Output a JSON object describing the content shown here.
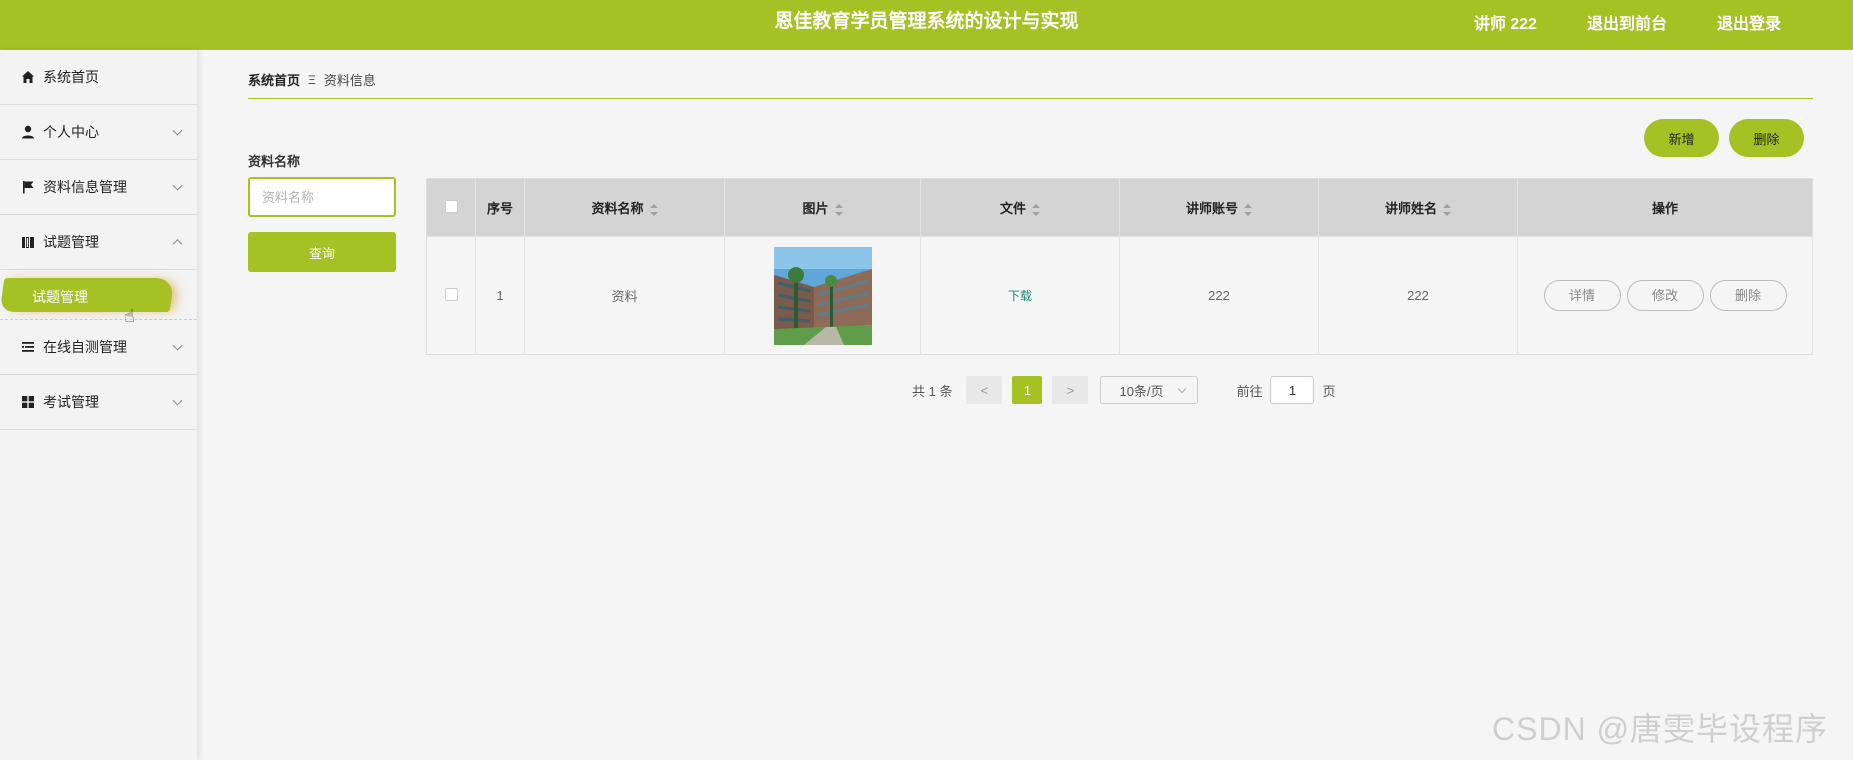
{
  "header": {
    "title": "恩佳教育学员管理系统的设计与实现",
    "user": "讲师 222",
    "to_front": "退出到前台",
    "logout": "退出登录"
  },
  "sidebar": {
    "items": [
      {
        "label": "系统首页",
        "icon": "home-icon"
      },
      {
        "label": "个人中心",
        "icon": "user-icon"
      },
      {
        "label": "资料信息管理",
        "icon": "flag-icon"
      },
      {
        "label": "试题管理",
        "icon": "book-icon"
      },
      {
        "label": "在线自测管理",
        "icon": "list-icon"
      },
      {
        "label": "考试管理",
        "icon": "grid-icon"
      }
    ],
    "submenu_active": "试题管理"
  },
  "breadcrumb": {
    "home": "系统首页",
    "separator": "Ξ",
    "current": "资料信息"
  },
  "search": {
    "label": "资料名称",
    "placeholder": "资料名称",
    "button": "查询"
  },
  "actions": {
    "add": "新增",
    "delete": "删除"
  },
  "table": {
    "headers": [
      "序号",
      "资料名称",
      "图片",
      "文件",
      "讲师账号",
      "讲师姓名",
      "操作"
    ],
    "rows": [
      {
        "index": "1",
        "name": "资料",
        "file": "下载",
        "teacher_account": "222",
        "teacher_name": "222",
        "ops": [
          "详情",
          "修改",
          "删除"
        ]
      }
    ]
  },
  "pagination": {
    "total": "共 1 条",
    "prev": "<",
    "current": "1",
    "next": ">",
    "page_size": "10条/页",
    "goto_label": "前往",
    "goto_value": "1",
    "page_unit": "页"
  },
  "watermark": "CSDN @唐雯毕设程序",
  "colors": {
    "accent": "#a6c124",
    "link": "#1a8a7a"
  }
}
